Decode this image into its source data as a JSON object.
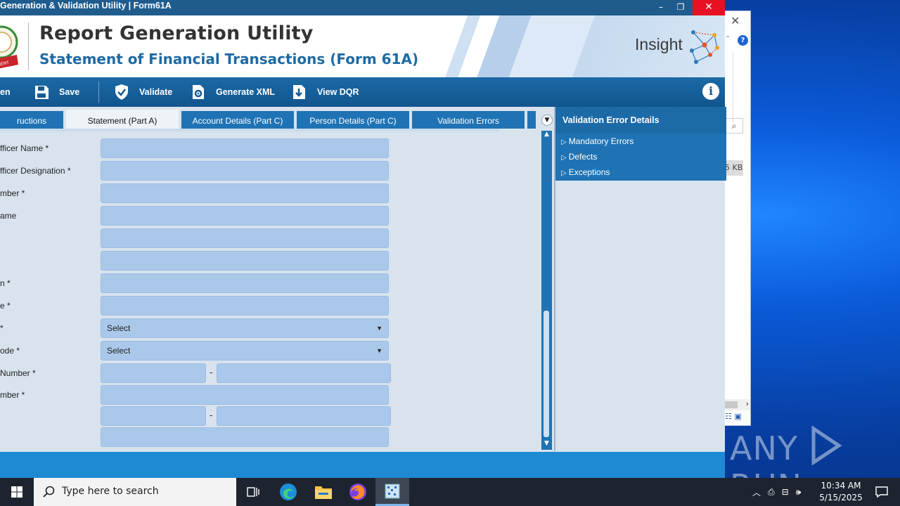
{
  "window": {
    "title": "Generation & Validation Utility | Form61A",
    "controls": {
      "minimize": "–",
      "restore": "❐",
      "close": "✕"
    }
  },
  "banner": {
    "title": "Report Generation Utility",
    "subtitle": "Statement of Financial Transactions (Form 61A)",
    "brand": "Insight"
  },
  "toolbar": {
    "items": [
      {
        "label": "en",
        "icon": "open-icon"
      },
      {
        "label": "Save",
        "icon": "save-icon"
      },
      {
        "label": "Validate",
        "icon": "validate-shield-icon"
      },
      {
        "label": "Generate XML",
        "icon": "generate-xml-icon"
      },
      {
        "label": "View DQR",
        "icon": "download-doc-icon"
      }
    ],
    "info_icon": "i"
  },
  "tabs": [
    {
      "label": "ructions",
      "active": false
    },
    {
      "label": "Statement (Part A)",
      "active": true
    },
    {
      "label": "Account Details (Part C)",
      "active": false
    },
    {
      "label": "Person Details (Part C)",
      "active": false
    },
    {
      "label": "Validation Errors",
      "active": false
    }
  ],
  "form": {
    "rows": [
      {
        "label": "fficer Name *",
        "value": ""
      },
      {
        "label": "fficer Designation *",
        "value": ""
      },
      {
        "label": "mber *",
        "value": ""
      },
      {
        "label": "ame",
        "value": ""
      },
      {
        "label": "",
        "value": ""
      },
      {
        "label": "",
        "value": ""
      },
      {
        "label": "n *",
        "value": ""
      },
      {
        "label": "e *",
        "value": ""
      },
      {
        "label": "*",
        "select": "Select"
      },
      {
        "label": "ode *",
        "select": "Select"
      },
      {
        "label": " Number *",
        "split": [
          "",
          ""
        ]
      },
      {
        "label": "mber *",
        "value": ""
      },
      {
        "label": "",
        "split": [
          "",
          ""
        ]
      },
      {
        "label": "",
        "value": ""
      }
    ],
    "split_separator": "-"
  },
  "error_panel": {
    "title": "Validation Error Details",
    "items": [
      "Mandatory Errors",
      "Defects",
      "Exceptions"
    ]
  },
  "bg_window": {
    "size_label": "5 KB"
  },
  "watermark": {
    "text_left": "ANY",
    "text_right": "RUN"
  },
  "taskbar": {
    "search_placeholder": "Type here to search",
    "time": "10:34 AM",
    "date": "5/15/2025"
  }
}
